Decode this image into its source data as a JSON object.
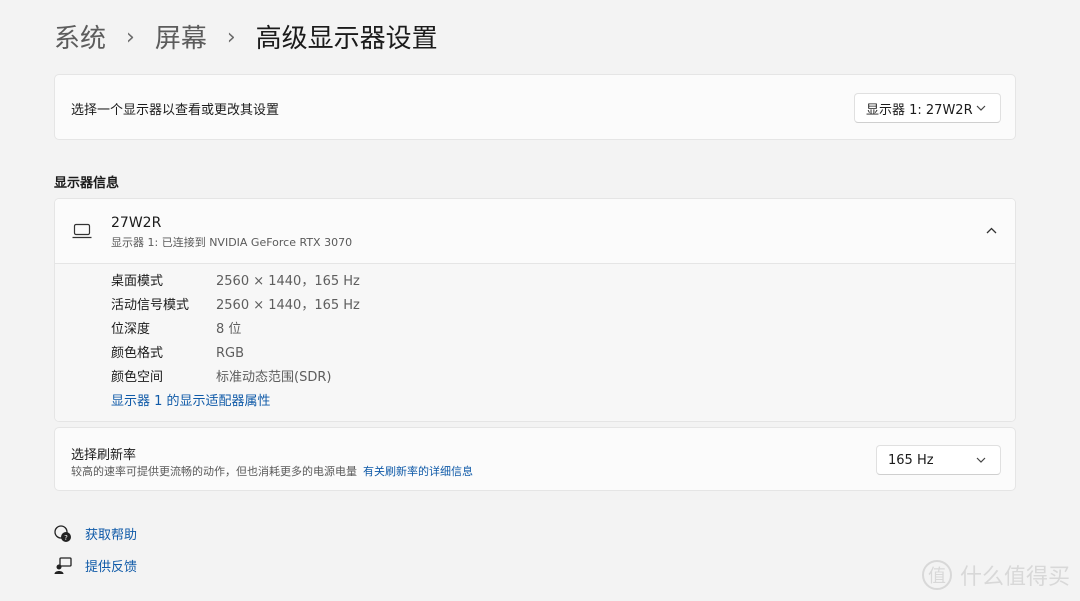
{
  "breadcrumb": {
    "items": [
      "系统",
      "屏幕",
      "高级显示器设置"
    ],
    "separator": "›"
  },
  "select_display": {
    "label": "选择一个显示器以查看或更改其设置",
    "dropdown_value": "显示器 1: 27W2R"
  },
  "display_info": {
    "section_title": "显示器信息",
    "monitor_name": "27W2R",
    "monitor_subtitle": "显示器 1: 已连接到 NVIDIA GeForce RTX 3070",
    "properties": [
      {
        "key": "桌面模式",
        "value": "2560 × 1440，165 Hz"
      },
      {
        "key": "活动信号模式",
        "value": "2560 × 1440，165 Hz"
      },
      {
        "key": "位深度",
        "value": "8 位"
      },
      {
        "key": "颜色格式",
        "value": "RGB"
      },
      {
        "key": "颜色空间",
        "value": "标准动态范围(SDR)"
      }
    ],
    "adapter_link": "显示器 1 的显示适配器属性"
  },
  "refresh_rate": {
    "title": "选择刷新率",
    "subtitle": "较高的速率可提供更流畅的动作，但也消耗更多的电源电量",
    "link": "有关刷新率的详细信息",
    "dropdown_value": "165 Hz"
  },
  "footer": {
    "help": "获取帮助",
    "feedback": "提供反馈"
  },
  "watermark": {
    "logo_char": "值",
    "text": "什么值得买"
  },
  "colors": {
    "accent_link": "#0f5aa8",
    "background": "#f3f3f3",
    "card": "#fbfbfb"
  },
  "icons": {
    "monitor": "laptop-monitor-icon",
    "expand": "chevron-up-icon",
    "dropdown": "chevron-down-icon",
    "help": "help-bubble-icon",
    "feedback": "feedback-person-icon"
  }
}
